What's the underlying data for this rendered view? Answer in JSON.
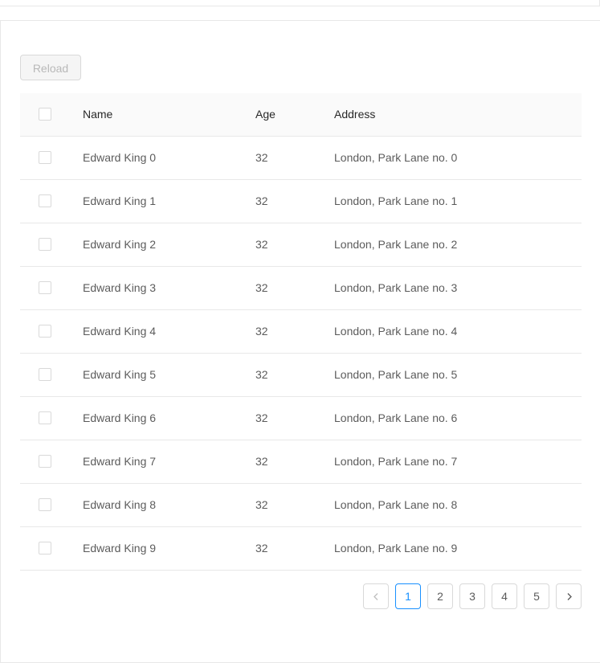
{
  "toolbar": {
    "reload_label": "Reload"
  },
  "table": {
    "columns": {
      "name": "Name",
      "age": "Age",
      "address": "Address"
    },
    "rows": [
      {
        "name": "Edward King 0",
        "age": "32",
        "address": "London, Park Lane no. 0"
      },
      {
        "name": "Edward King 1",
        "age": "32",
        "address": "London, Park Lane no. 1"
      },
      {
        "name": "Edward King 2",
        "age": "32",
        "address": "London, Park Lane no. 2"
      },
      {
        "name": "Edward King 3",
        "age": "32",
        "address": "London, Park Lane no. 3"
      },
      {
        "name": "Edward King 4",
        "age": "32",
        "address": "London, Park Lane no. 4"
      },
      {
        "name": "Edward King 5",
        "age": "32",
        "address": "London, Park Lane no. 5"
      },
      {
        "name": "Edward King 6",
        "age": "32",
        "address": "London, Park Lane no. 6"
      },
      {
        "name": "Edward King 7",
        "age": "32",
        "address": "London, Park Lane no. 7"
      },
      {
        "name": "Edward King 8",
        "age": "32",
        "address": "London, Park Lane no. 8"
      },
      {
        "name": "Edward King 9",
        "age": "32",
        "address": "London, Park Lane no. 9"
      }
    ]
  },
  "pagination": {
    "pages": [
      "1",
      "2",
      "3",
      "4",
      "5"
    ],
    "current": "1",
    "prev_icon": "chevron-left-icon",
    "next_icon": "chevron-right-icon"
  },
  "colors": {
    "accent": "#1890ff",
    "border": "#e8e8e8",
    "header_bg": "#fafafa"
  }
}
